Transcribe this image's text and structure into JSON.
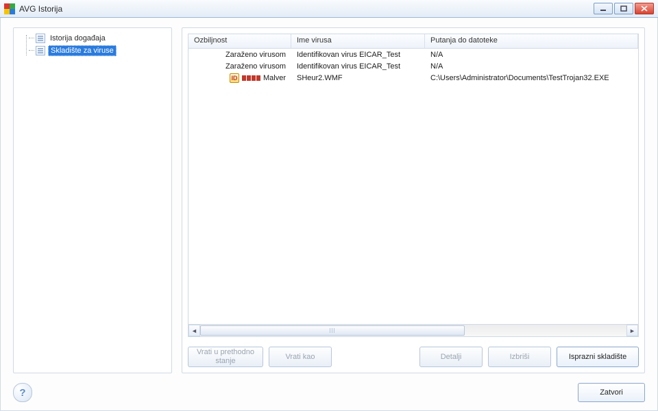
{
  "window": {
    "title": "AVG Istorija"
  },
  "sidebar": {
    "items": [
      {
        "label": "Istorija događaja",
        "selected": false
      },
      {
        "label": "Skladište za viruse",
        "selected": true
      }
    ]
  },
  "table": {
    "headers": {
      "severity": "Ozbiljnost",
      "virus_name": "Ime virusa",
      "file_path": "Putanja do datoteke"
    },
    "rows": [
      {
        "severity_label": "Zaraženo virusom",
        "virus_name": "Identifikovan virus EICAR_Test",
        "file_path": "N/A",
        "malware_badge": false
      },
      {
        "severity_label": "Zaraženo virusom",
        "virus_name": "Identifikovan virus EICAR_Test",
        "file_path": "N/A",
        "malware_badge": false
      },
      {
        "severity_label": "Malver",
        "virus_name": "SHeur2.WMF",
        "file_path": "C:\\Users\\Administrator\\Documents\\TestTrojan32.EXE",
        "malware_badge": true
      }
    ]
  },
  "buttons": {
    "restore_prev": "Vrati u prethodno stanje",
    "restore_as": "Vrati kao",
    "details": "Detalji",
    "delete": "Izbriši",
    "empty_vault": "Isprazni skladište",
    "close": "Zatvori",
    "help": "?"
  }
}
